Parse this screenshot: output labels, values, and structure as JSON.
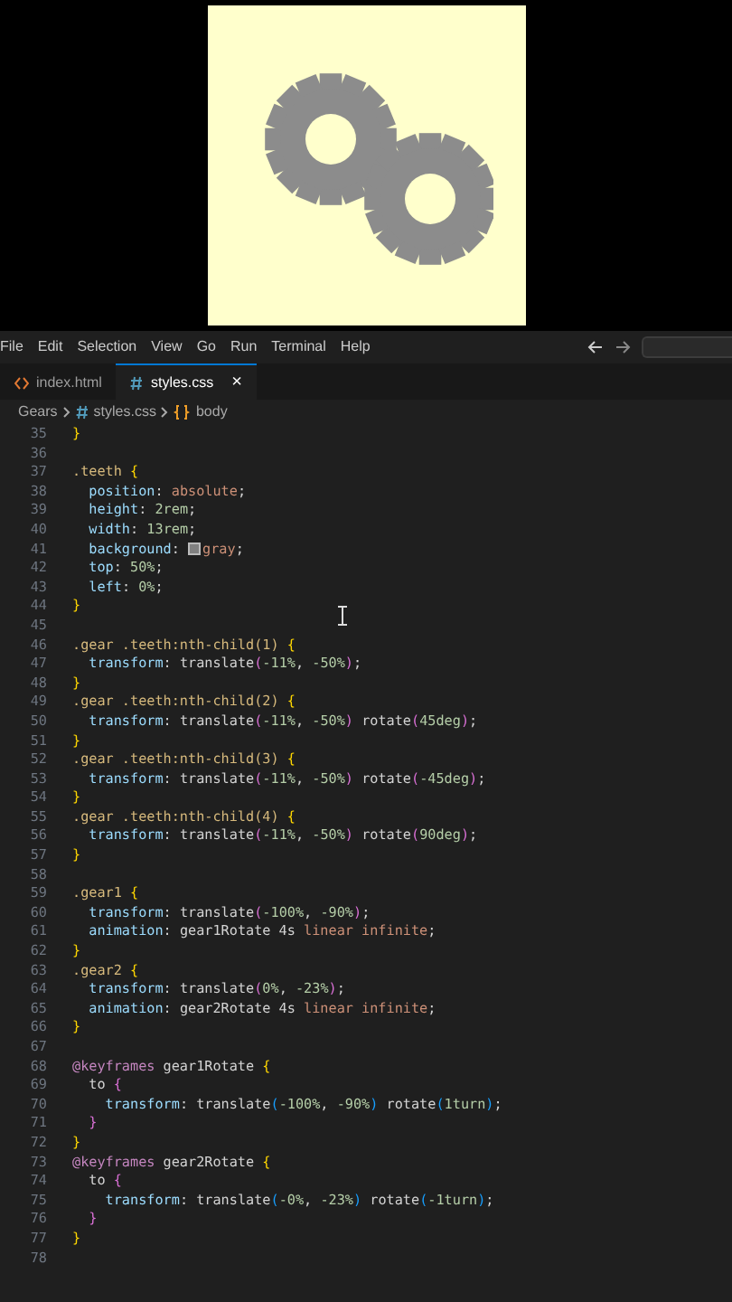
{
  "menu": [
    "File",
    "Edit",
    "Selection",
    "View",
    "Go",
    "Run",
    "Terminal",
    "Help"
  ],
  "tabs": [
    {
      "label": "index.html",
      "kind": "html",
      "selected": false
    },
    {
      "label": "styles.css",
      "kind": "css",
      "selected": true,
      "close": "×"
    }
  ],
  "breadcrumb": [
    {
      "label": "Gears",
      "kind": "folder"
    },
    {
      "label": "styles.css",
      "kind": "css"
    },
    {
      "label": "body",
      "kind": "symbol"
    }
  ],
  "lines": [
    {
      "number": "35",
      "tokens": [
        {
          "kind": "b1",
          "text": "}"
        }
      ]
    },
    {
      "number": "36"
    },
    {
      "number": "37",
      "tokens": [
        {
          "kind": "sel",
          "text": ".teeth"
        },
        {
          "kind": "b1",
          "text": " {"
        }
      ]
    },
    {
      "number": "38",
      "tokens": [
        {
          "kind": "prop",
          "text": "  position"
        },
        {
          "kind": "plain",
          "text": ": "
        },
        {
          "kind": "val",
          "text": "absolute"
        },
        {
          "kind": "plain",
          "text": ";"
        }
      ]
    },
    {
      "number": "39",
      "tokens": [
        {
          "kind": "prop",
          "text": "  height"
        },
        {
          "kind": "plain",
          "text": ": "
        },
        {
          "kind": "num",
          "text": "2rem"
        },
        {
          "kind": "plain",
          "text": ";"
        }
      ]
    },
    {
      "number": "40",
      "tokens": [
        {
          "kind": "prop",
          "text": "  width"
        },
        {
          "kind": "plain",
          "text": ": "
        },
        {
          "kind": "num",
          "text": "13rem"
        },
        {
          "kind": "plain",
          "text": ";"
        }
      ]
    },
    {
      "number": "41",
      "tokens": [
        {
          "kind": "prop",
          "text": "  background"
        },
        {
          "kind": "plain",
          "text": ": "
        },
        {
          "kind": "swatch"
        },
        {
          "kind": "val",
          "text": "gray"
        },
        {
          "kind": "plain",
          "text": ";"
        }
      ]
    },
    {
      "number": "42",
      "tokens": [
        {
          "kind": "prop",
          "text": "  top"
        },
        {
          "kind": "plain",
          "text": ": "
        },
        {
          "kind": "num",
          "text": "50%"
        },
        {
          "kind": "plain",
          "text": ";"
        }
      ]
    },
    {
      "number": "43",
      "tokens": [
        {
          "kind": "prop",
          "text": "  left"
        },
        {
          "kind": "plain",
          "text": ": "
        },
        {
          "kind": "num",
          "text": "0%"
        },
        {
          "kind": "plain",
          "text": ";"
        }
      ]
    },
    {
      "number": "44",
      "tokens": [
        {
          "kind": "b1",
          "text": "}"
        }
      ]
    },
    {
      "number": "45"
    },
    {
      "number": "46",
      "tokens": [
        {
          "kind": "sel",
          "text": ".gear .teeth:nth-child(1)"
        },
        {
          "kind": "b1",
          "text": " {"
        }
      ]
    },
    {
      "number": "47",
      "tokens": [
        {
          "kind": "prop",
          "text": "  transform"
        },
        {
          "kind": "plain",
          "text": ": translate"
        },
        {
          "kind": "b2",
          "text": "("
        },
        {
          "kind": "num",
          "text": "-11%"
        },
        {
          "kind": "plain",
          "text": ", "
        },
        {
          "kind": "num",
          "text": "-50%"
        },
        {
          "kind": "b2",
          "text": ")"
        },
        {
          "kind": "plain",
          "text": ";"
        }
      ]
    },
    {
      "number": "48",
      "tokens": [
        {
          "kind": "b1",
          "text": "}"
        }
      ]
    },
    {
      "number": "49",
      "tokens": [
        {
          "kind": "sel",
          "text": ".gear .teeth:nth-child(2)"
        },
        {
          "kind": "b1",
          "text": " {"
        }
      ]
    },
    {
      "number": "50",
      "tokens": [
        {
          "kind": "prop",
          "text": "  transform"
        },
        {
          "kind": "plain",
          "text": ": translate"
        },
        {
          "kind": "b2",
          "text": "("
        },
        {
          "kind": "num",
          "text": "-11%"
        },
        {
          "kind": "plain",
          "text": ", "
        },
        {
          "kind": "num",
          "text": "-50%"
        },
        {
          "kind": "b2",
          "text": ")"
        },
        {
          "kind": "plain",
          "text": " rotate"
        },
        {
          "kind": "b2",
          "text": "("
        },
        {
          "kind": "num",
          "text": "45deg"
        },
        {
          "kind": "b2",
          "text": ")"
        },
        {
          "kind": "plain",
          "text": ";"
        }
      ]
    },
    {
      "number": "51",
      "tokens": [
        {
          "kind": "b1",
          "text": "}"
        }
      ]
    },
    {
      "number": "52",
      "tokens": [
        {
          "kind": "sel",
          "text": ".gear .teeth:nth-child(3)"
        },
        {
          "kind": "b1",
          "text": " {"
        }
      ]
    },
    {
      "number": "53",
      "tokens": [
        {
          "kind": "prop",
          "text": "  transform"
        },
        {
          "kind": "plain",
          "text": ": translate"
        },
        {
          "kind": "b2",
          "text": "("
        },
        {
          "kind": "num",
          "text": "-11%"
        },
        {
          "kind": "plain",
          "text": ", "
        },
        {
          "kind": "num",
          "text": "-50%"
        },
        {
          "kind": "b2",
          "text": ")"
        },
        {
          "kind": "plain",
          "text": " rotate"
        },
        {
          "kind": "b2",
          "text": "("
        },
        {
          "kind": "num",
          "text": "-45deg"
        },
        {
          "kind": "b2",
          "text": ")"
        },
        {
          "kind": "plain",
          "text": ";"
        }
      ]
    },
    {
      "number": "54",
      "tokens": [
        {
          "kind": "b1",
          "text": "}"
        }
      ]
    },
    {
      "number": "55",
      "tokens": [
        {
          "kind": "sel",
          "text": ".gear .teeth:nth-child(4)"
        },
        {
          "kind": "b1",
          "text": " {"
        }
      ]
    },
    {
      "number": "56",
      "tokens": [
        {
          "kind": "prop",
          "text": "  transform"
        },
        {
          "kind": "plain",
          "text": ": translate"
        },
        {
          "kind": "b2",
          "text": "("
        },
        {
          "kind": "num",
          "text": "-11%"
        },
        {
          "kind": "plain",
          "text": ", "
        },
        {
          "kind": "num",
          "text": "-50%"
        },
        {
          "kind": "b2",
          "text": ")"
        },
        {
          "kind": "plain",
          "text": " rotate"
        },
        {
          "kind": "b2",
          "text": "("
        },
        {
          "kind": "num",
          "text": "90deg"
        },
        {
          "kind": "b2",
          "text": ")"
        },
        {
          "kind": "plain",
          "text": ";"
        }
      ]
    },
    {
      "number": "57",
      "tokens": [
        {
          "kind": "b1",
          "text": "}"
        }
      ]
    },
    {
      "number": "58"
    },
    {
      "number": "59",
      "tokens": [
        {
          "kind": "sel",
          "text": ".gear1"
        },
        {
          "kind": "b1",
          "text": " {"
        }
      ]
    },
    {
      "number": "60",
      "tokens": [
        {
          "kind": "prop",
          "text": "  transform"
        },
        {
          "kind": "plain",
          "text": ": translate"
        },
        {
          "kind": "b2",
          "text": "("
        },
        {
          "kind": "num",
          "text": "-100%"
        },
        {
          "kind": "plain",
          "text": ", "
        },
        {
          "kind": "num",
          "text": "-90%"
        },
        {
          "kind": "b2",
          "text": ")"
        },
        {
          "kind": "plain",
          "text": ";"
        }
      ]
    },
    {
      "number": "61",
      "tokens": [
        {
          "kind": "prop",
          "text": "  animation"
        },
        {
          "kind": "plain",
          "text": ": gear1Rotate 4s "
        },
        {
          "kind": "val",
          "text": "linear infinite"
        },
        {
          "kind": "plain",
          "text": ";"
        }
      ]
    },
    {
      "number": "62",
      "tokens": [
        {
          "kind": "b1",
          "text": "}"
        }
      ]
    },
    {
      "number": "63",
      "tokens": [
        {
          "kind": "sel",
          "text": ".gear2"
        },
        {
          "kind": "b1",
          "text": " {"
        }
      ]
    },
    {
      "number": "64",
      "tokens": [
        {
          "kind": "prop",
          "text": "  transform"
        },
        {
          "kind": "plain",
          "text": ": translate"
        },
        {
          "kind": "b2",
          "text": "("
        },
        {
          "kind": "num",
          "text": "0%"
        },
        {
          "kind": "plain",
          "text": ", "
        },
        {
          "kind": "num",
          "text": "-23%"
        },
        {
          "kind": "b2",
          "text": ")"
        },
        {
          "kind": "plain",
          "text": ";"
        }
      ]
    },
    {
      "number": "65",
      "tokens": [
        {
          "kind": "prop",
          "text": "  animation"
        },
        {
          "kind": "plain",
          "text": ": gear2Rotate 4s "
        },
        {
          "kind": "val",
          "text": "linear infinite"
        },
        {
          "kind": "plain",
          "text": ";"
        }
      ]
    },
    {
      "number": "66",
      "tokens": [
        {
          "kind": "b1",
          "text": "}"
        }
      ]
    },
    {
      "number": "67"
    },
    {
      "number": "68",
      "tokens": [
        {
          "kind": "at",
          "text": "@keyframes"
        },
        {
          "kind": "plain",
          "text": " gear1Rotate "
        },
        {
          "kind": "b1",
          "text": "{"
        }
      ]
    },
    {
      "number": "69",
      "tokens": [
        {
          "kind": "plain",
          "text": "  to "
        },
        {
          "kind": "b2",
          "text": "{"
        }
      ]
    },
    {
      "number": "70",
      "tokens": [
        {
          "kind": "prop",
          "text": "    transform"
        },
        {
          "kind": "plain",
          "text": ": translate"
        },
        {
          "kind": "b3",
          "text": "("
        },
        {
          "kind": "num",
          "text": "-100%"
        },
        {
          "kind": "plain",
          "text": ", "
        },
        {
          "kind": "num",
          "text": "-90%"
        },
        {
          "kind": "b3",
          "text": ")"
        },
        {
          "kind": "plain",
          "text": " rotate"
        },
        {
          "kind": "b3",
          "text": "("
        },
        {
          "kind": "num",
          "text": "1turn"
        },
        {
          "kind": "b3",
          "text": ")"
        },
        {
          "kind": "plain",
          "text": ";"
        }
      ]
    },
    {
      "number": "71",
      "tokens": [
        {
          "kind": "b2",
          "text": "  }"
        }
      ]
    },
    {
      "number": "72",
      "tokens": [
        {
          "kind": "b1",
          "text": "}"
        }
      ]
    },
    {
      "number": "73",
      "tokens": [
        {
          "kind": "at",
          "text": "@keyframes"
        },
        {
          "kind": "plain",
          "text": " gear2Rotate "
        },
        {
          "kind": "b1",
          "text": "{"
        }
      ]
    },
    {
      "number": "74",
      "tokens": [
        {
          "kind": "plain",
          "text": "  to "
        },
        {
          "kind": "b2",
          "text": "{"
        }
      ]
    },
    {
      "number": "75",
      "tokens": [
        {
          "kind": "prop",
          "text": "    transform"
        },
        {
          "kind": "plain",
          "text": ": translate"
        },
        {
          "kind": "b3",
          "text": "("
        },
        {
          "kind": "num",
          "text": "-0%"
        },
        {
          "kind": "plain",
          "text": ", "
        },
        {
          "kind": "num",
          "text": "-23%"
        },
        {
          "kind": "b3",
          "text": ")"
        },
        {
          "kind": "plain",
          "text": " rotate"
        },
        {
          "kind": "b3",
          "text": "("
        },
        {
          "kind": "num",
          "text": "-1turn"
        },
        {
          "kind": "b3",
          "text": ")"
        },
        {
          "kind": "plain",
          "text": ";"
        }
      ]
    },
    {
      "number": "76",
      "tokens": [
        {
          "kind": "b2",
          "text": "  }"
        }
      ]
    },
    {
      "number": "77",
      "tokens": [
        {
          "kind": "b1",
          "text": "}"
        }
      ]
    },
    {
      "number": "78"
    }
  ]
}
